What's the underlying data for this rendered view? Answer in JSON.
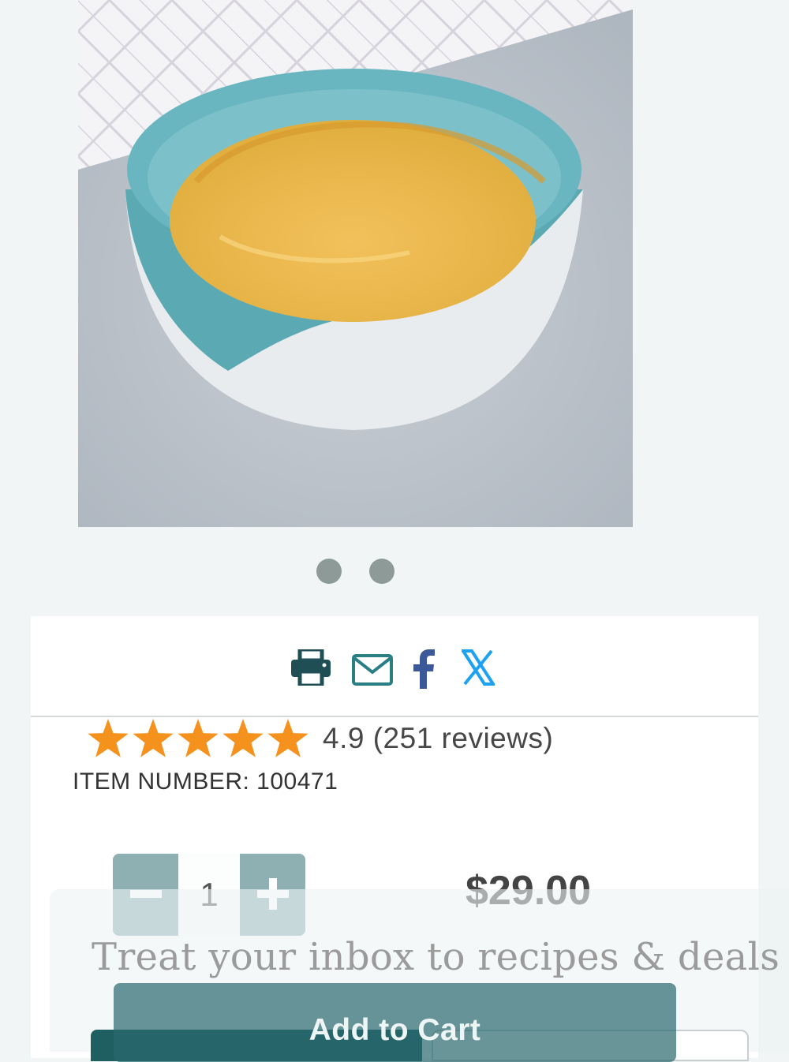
{
  "product": {
    "image_alt": "Blue and white mixing bowl with batter",
    "carousel": {
      "count": 2,
      "active": 0
    }
  },
  "share": {
    "icons": [
      "print-icon",
      "mail-icon",
      "facebook-icon",
      "x-icon"
    ],
    "colors": {
      "print": "#1f4f55",
      "mail": "#2a7f87",
      "facebook": "#3b5998",
      "x": "#1da1f2"
    }
  },
  "rating": {
    "stars": 5,
    "text": "4.9 (251 reviews)",
    "star_color": "#f5921e"
  },
  "item_number": "ITEM NUMBER: 100471",
  "quantity": {
    "value": "1",
    "minus_label": "−",
    "plus_label": "+"
  },
  "price": "$29.00",
  "newsletter": {
    "headline": "Treat your inbox to recipes & deals"
  },
  "cta": {
    "add_to_cart": "Add to Cart",
    "color": "#2a686e"
  }
}
